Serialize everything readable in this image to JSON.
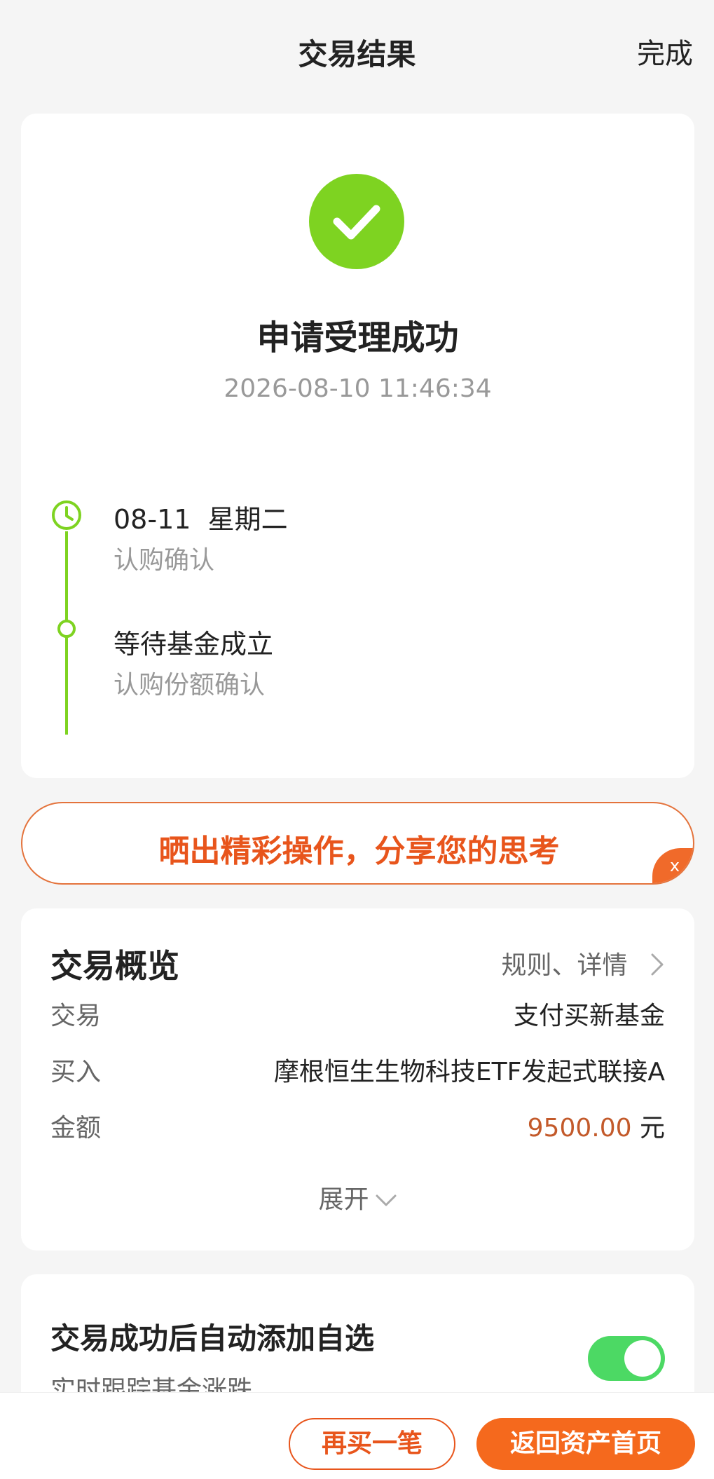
{
  "header": {
    "title": "交易结果",
    "done_label": "完成"
  },
  "result": {
    "status_icon": "check-circle-icon",
    "status_color": "#7ed321",
    "title": "申请受理成功",
    "time": "2026-08-10 11:46:34"
  },
  "timeline": {
    "steps": [
      {
        "title": "08-11  星期二",
        "subtitle": "认购确认",
        "icon": "clock-icon"
      },
      {
        "title": "等待基金成立",
        "subtitle": "认购份额确认",
        "icon": "dot-icon"
      }
    ]
  },
  "share": {
    "text": "晒出精彩操作，分享您的思考",
    "close_label": "x"
  },
  "overview": {
    "title": "交易概览",
    "link_label": "规则、详情",
    "rows": [
      {
        "label": "交易",
        "value": "支付买新基金"
      },
      {
        "label": "买入",
        "value": "摩根恒生生物科技ETF发起式联接A"
      },
      {
        "label": "金额",
        "value": "9500.00",
        "unit": "元"
      }
    ],
    "expand_label": "展开"
  },
  "auto_add": {
    "title": "交易成功后自动添加自选",
    "subtitle": "实时跟踪基金涨跌",
    "enabled": true
  },
  "bottom": {
    "again_label": "再买一笔",
    "home_label": "返回资产首页"
  },
  "colors": {
    "accent": "#f5691d",
    "success": "#7ed321",
    "amount": "#c35a2b",
    "toggle_on": "#4cd964"
  }
}
